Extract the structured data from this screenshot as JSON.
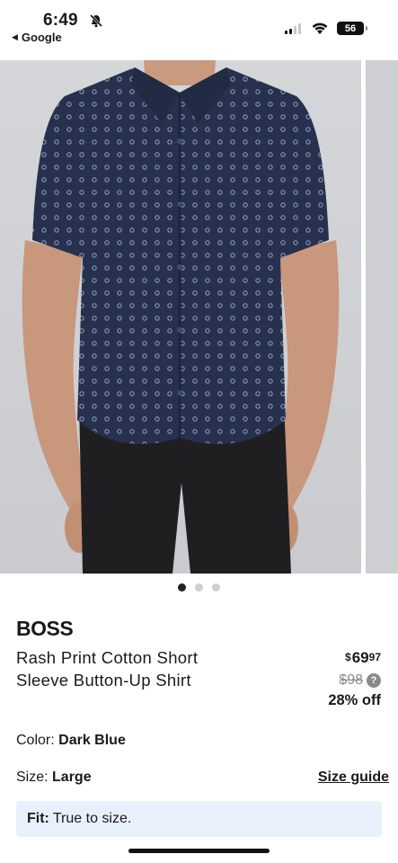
{
  "status_bar": {
    "time": "6:49",
    "back_app": "Google",
    "battery": "56"
  },
  "gallery": {
    "pages": 3,
    "active_page": 1,
    "icons": [
      "bell-slash-icon",
      "signal-icon",
      "wifi-icon",
      "battery-icon"
    ]
  },
  "product": {
    "brand": "BOSS",
    "name": "Rash Print Cotton Short Sleeve Button-Up Shirt",
    "price": {
      "currency": "$",
      "dollars": "69",
      "cents": "97",
      "original": "$98",
      "discount": "28% off"
    },
    "color_label": "Color:",
    "color_value": "Dark Blue",
    "size_label": "Size:",
    "size_value": "Large",
    "size_guide": "Size guide",
    "fit_label": "Fit:",
    "fit_value": "True to size."
  },
  "colors": {
    "shirt": "#27314d",
    "fit_bg": "#e8f1fb"
  }
}
